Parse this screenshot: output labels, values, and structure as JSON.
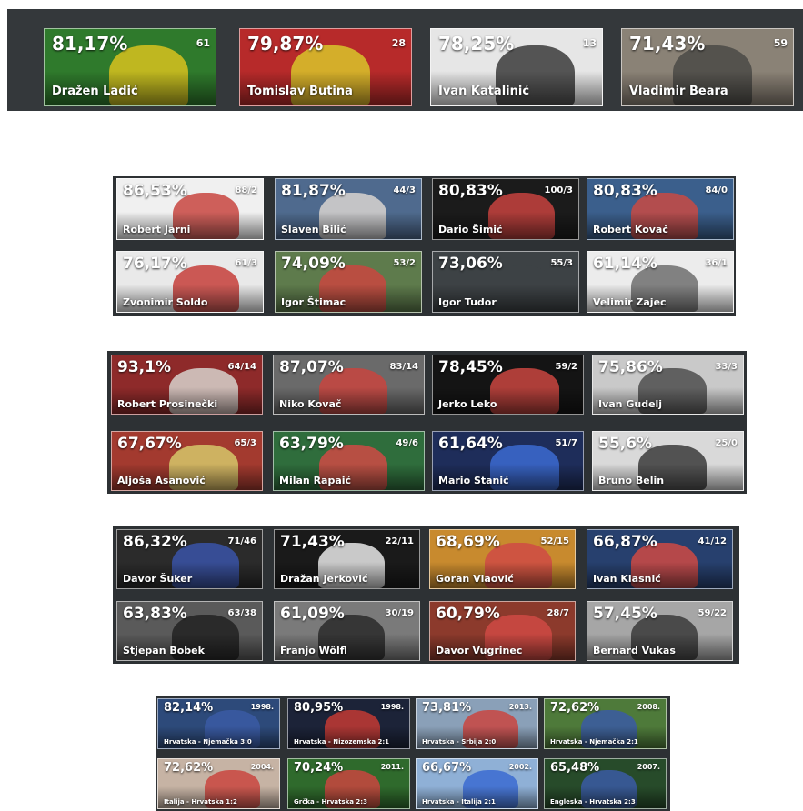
{
  "colors": {
    "panel": "#2d3134",
    "text": "#ffffff"
  },
  "sections": [
    {
      "cards": [
        {
          "pct": "81,17%",
          "num": "61",
          "name": "Dražen Ladić",
          "bg": "#2f7a2c",
          "fig": "#d8c21e"
        },
        {
          "pct": "79,87%",
          "num": "28",
          "name": "Tomislav Butina",
          "bg": "#b72a2a",
          "fig": "#d9c52a"
        },
        {
          "pct": "78,25%",
          "num": "13",
          "name": "Ivan Katalinić",
          "bg": "#e6e6e6",
          "fig": "#3a3a3a"
        },
        {
          "pct": "71,43%",
          "num": "59",
          "name": "Vladimir Beara",
          "bg": "#8a8276",
          "fig": "#4a4a46"
        }
      ]
    },
    {
      "cards": [
        {
          "pct": "86,53%",
          "num": "88/2",
          "name": "Robert Jarni",
          "bg": "#f0f0f0",
          "fig": "#c8453f"
        },
        {
          "pct": "81,87%",
          "num": "44/3",
          "name": "Slaven Bilić",
          "bg": "#4f6a8e",
          "fig": "#d8d4d0"
        },
        {
          "pct": "80,83%",
          "num": "100/3",
          "name": "Dario Šimić",
          "bg": "#1b1b1b",
          "fig": "#c7423e"
        },
        {
          "pct": "80,83%",
          "num": "84/0",
          "name": "Robert Kovač",
          "bg": "#3b5f8c",
          "fig": "#c94a43"
        },
        {
          "pct": "76,17%",
          "num": "61/3",
          "name": "Zvonimir Soldo",
          "bg": "#e9e9e9",
          "fig": "#c53e3a"
        },
        {
          "pct": "74,09%",
          "num": "53/2",
          "name": "Igor Štimac",
          "bg": "#5e7b4c",
          "fig": "#c9463f"
        },
        {
          "pct": "73,06%",
          "num": "55/3",
          "name": "Igor Tudor",
          "bg": "#3d4245",
          "fig": "#3d4245"
        },
        {
          "pct": "61,14%",
          "num": "36/1",
          "name": "Velimir Zajec",
          "bg": "#ececec",
          "fig": "#6e6e6e"
        }
      ]
    },
    {
      "cards": [
        {
          "pct": "93,1%",
          "num": "64/14",
          "name": "Robert Prosinečki",
          "bg": "#8e2a2a",
          "fig": "#d7d2cc"
        },
        {
          "pct": "87,07%",
          "num": "83/14",
          "name": "Niko Kovač",
          "bg": "#6a6a6a",
          "fig": "#c8443e"
        },
        {
          "pct": "78,45%",
          "num": "59/2",
          "name": "Jerko Leko",
          "bg": "#141414",
          "fig": "#c9453f"
        },
        {
          "pct": "75,86%",
          "num": "33/3",
          "name": "Ivan Gudelj",
          "bg": "#c9c9c9",
          "fig": "#4d4d4d"
        },
        {
          "pct": "67,67%",
          "num": "65/3",
          "name": "Aljoša Asanović",
          "bg": "#a33a2f",
          "fig": "#d6c86a"
        },
        {
          "pct": "63,79%",
          "num": "49/6",
          "name": "Milan Rapaić",
          "bg": "#2f6d3c",
          "fig": "#cf4a44"
        },
        {
          "pct": "61,64%",
          "num": "51/7",
          "name": "Mario Stanić",
          "bg": "#1e2d5a",
          "fig": "#3c6bd1"
        },
        {
          "pct": "55,6%",
          "num": "25/0",
          "name": "Bruno Belin",
          "bg": "#d9d9d9",
          "fig": "#3a3a3a"
        }
      ]
    },
    {
      "cards": [
        {
          "pct": "86,32%",
          "num": "71/46",
          "name": "Davor Šuker",
          "bg": "#2b2b2b",
          "fig": "#3953a8"
        },
        {
          "pct": "71,43%",
          "num": "22/11",
          "name": "Dražan Jerković",
          "bg": "#1a1a1a",
          "fig": "#e9e9e9"
        },
        {
          "pct": "68,69%",
          "num": "52/15",
          "name": "Goran Vlaović",
          "bg": "#c88a2e",
          "fig": "#cf4a44"
        },
        {
          "pct": "66,87%",
          "num": "41/12",
          "name": "Ivan Klasnić",
          "bg": "#27406e",
          "fig": "#cf4a44"
        },
        {
          "pct": "63,83%",
          "num": "63/38",
          "name": "Stjepan Bobek",
          "bg": "#5a5a5a",
          "fig": "#222222"
        },
        {
          "pct": "61,09%",
          "num": "30/19",
          "name": "Franjo Wölfl",
          "bg": "#7a7a7a",
          "fig": "#2a2a2a"
        },
        {
          "pct": "60,79%",
          "num": "28/7",
          "name": "Davor Vugrinec",
          "bg": "#8c3a2c",
          "fig": "#cf4a44"
        },
        {
          "pct": "57,45%",
          "num": "59/22",
          "name": "Bernard Vukas",
          "bg": "#a6a6a6",
          "fig": "#3a3a3a"
        }
      ]
    },
    {
      "cards": [
        {
          "pct": "82,14%",
          "num": "1998.",
          "name": "Hrvatska - Njemačka 3:0",
          "bg": "#2d4a7a",
          "fig": "#3b5ba5"
        },
        {
          "pct": "80,95%",
          "num": "1998.",
          "name": "Hrvatska - Nizozemska 2:1",
          "bg": "#1c2338",
          "fig": "#c33a34"
        },
        {
          "pct": "73,81%",
          "num": "2013.",
          "name": "Hrvatska - Srbija 2:0",
          "bg": "#8aa0b8",
          "fig": "#c9453f"
        },
        {
          "pct": "72,62%",
          "num": "2008.",
          "name": "Hrvatska - Njemačka 2:1",
          "bg": "#4e7a3a",
          "fig": "#3b5ba5"
        },
        {
          "pct": "72,62%",
          "num": "2004.",
          "name": "Italija - Hrvatska 1:2",
          "bg": "#c6b3a4",
          "fig": "#c9453f"
        },
        {
          "pct": "70,24%",
          "num": "2011.",
          "name": "Grčka - Hrvatska 2:3",
          "bg": "#2f6a2c",
          "fig": "#c9453f"
        },
        {
          "pct": "66,67%",
          "num": "2002.",
          "name": "Hrvatska - Italija 2:1",
          "bg": "#8fb0d6",
          "fig": "#3b6bd1"
        },
        {
          "pct": "65,48%",
          "num": "2007.",
          "name": "Engleska - Hrvatska 2:3",
          "bg": "#274b2a",
          "fig": "#3b5ba5"
        }
      ]
    }
  ]
}
